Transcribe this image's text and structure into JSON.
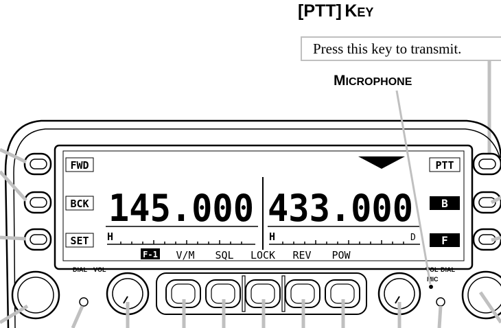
{
  "ptt_heading": {
    "bracket_open": "[",
    "key_name": "PTT",
    "bracket_close": "]",
    "word_initial": "K",
    "word_rest": "EY"
  },
  "ptt_callout": "Press this key to transmit.",
  "microphone_label": {
    "initial": "M",
    "rest": "ICROPHONE"
  },
  "display": {
    "left_keys": [
      "FWD",
      "BCK",
      "SET"
    ],
    "right_keys": [
      "PTT",
      "B",
      "F"
    ],
    "left_frequency": "145.000",
    "right_frequency": "433.000",
    "left_power": "H",
    "right_power": "H",
    "right_d": "D",
    "menu": [
      "F-1",
      "V/M",
      "SQL",
      "LOCK",
      "REV",
      "POW"
    ]
  },
  "knob_labels": {
    "left_dial": "DIAL",
    "left_vol": "VOL",
    "right_vol": "VOL",
    "right_dial": "DIAL",
    "mic": "MIC"
  },
  "colors": {
    "outline": "#000000",
    "leader": "#c0c0c0",
    "lcd_bg": "#ffffff"
  }
}
